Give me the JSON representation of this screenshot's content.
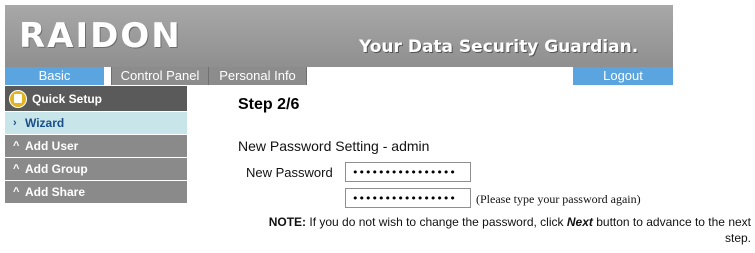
{
  "header": {
    "logo_text": "RAIDON",
    "tagline": "Your Data Security Guardian."
  },
  "nav": {
    "tabs": [
      {
        "label": "Basic"
      },
      {
        "label": "Control Panel"
      },
      {
        "label": "Personal Info"
      }
    ],
    "logout_label": "Logout"
  },
  "sidebar": {
    "header_label": "Quick Setup",
    "items": [
      {
        "label": "Wizard",
        "arrow": "›",
        "active": true
      },
      {
        "label": "Add User",
        "arrow": "^"
      },
      {
        "label": "Add Group",
        "arrow": "^"
      },
      {
        "label": "Add Share",
        "arrow": "^"
      }
    ]
  },
  "main": {
    "step_title": "Step 2/6",
    "section_title": "New Password Setting - admin",
    "password_label": "New Password",
    "password_value": "0123456789abcdef",
    "confirm_value": "0123456789abcdef",
    "confirm_hint": "(Please type your password again)",
    "note_prefix": "NOTE:",
    "note_text_1": "If you do not wish to change the password, click",
    "note_next": "Next",
    "note_text_2": "button to advance to the next step."
  },
  "colors": {
    "header_gray": "#9a9a9a",
    "tab_blue": "#5aa5e0",
    "tab_gray": "#8c8c8c",
    "sidebar_dark": "#5a5a5a",
    "sidebar_item": "#8a8a8a",
    "sidebar_active": "#c8e6ea"
  }
}
